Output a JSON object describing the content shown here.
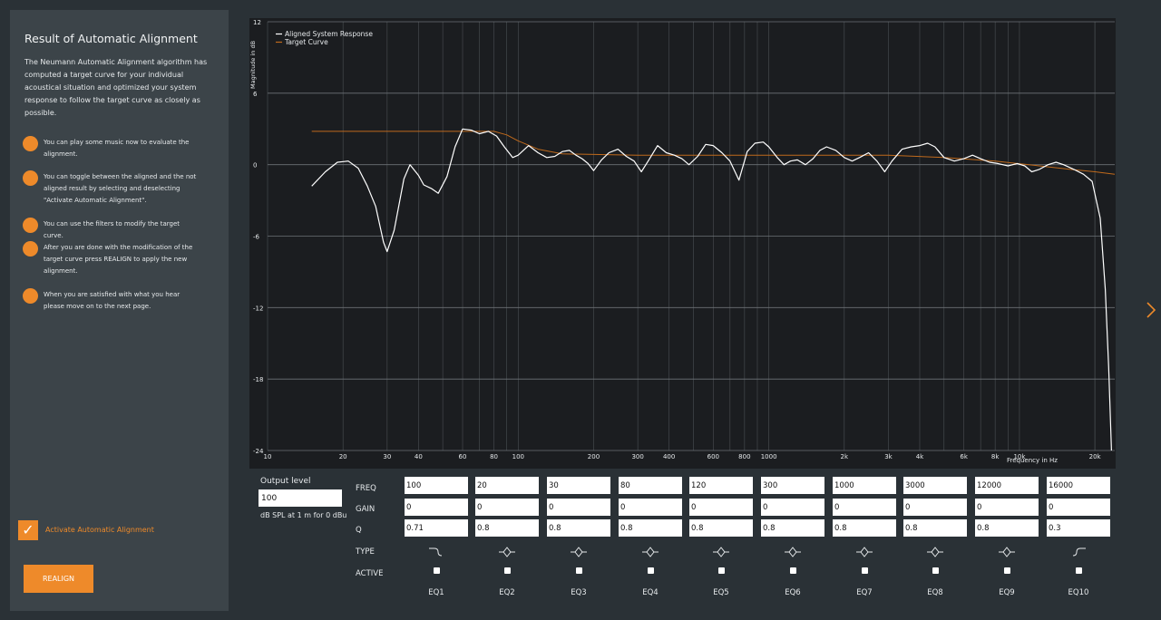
{
  "sidebar": {
    "title": "Result of Automatic Alignment",
    "description": "The Neumann Automatic Alignment algorithm has computed a target curve for your individual acoustical situation and optimized your system response to follow the target curve as closely as possible.",
    "tips": [
      "You can play some music now to evaluate the alignment.",
      "You can toggle between the aligned and the not aligned result by selecting and deselecting \"Activate Automatic Alignment\".",
      "You can use the filters to modify the target curve.",
      "After you are done with the modification of the target curve press REALIGN to apply the new alignment.",
      "When you are satisfied with what you hear please move on to the next page."
    ],
    "activate_checked": true,
    "activate_label": "Activate Automatic Alignment",
    "realign_label": "REALIGN"
  },
  "output": {
    "label": "Output level",
    "value": "100",
    "unit": "dB SPL at 1 m for 0 dBu"
  },
  "eq": {
    "row_labels": {
      "freq": "FREQ",
      "gain": "GAIN",
      "q": "Q",
      "type": "TYPE",
      "active": "ACTIVE"
    },
    "bands": [
      {
        "name": "EQ1",
        "freq": "100",
        "gain": "0",
        "q": "0.71",
        "type": "low-shelf-icon",
        "active": false
      },
      {
        "name": "EQ2",
        "freq": "20",
        "gain": "0",
        "q": "0.8",
        "type": "peak-icon",
        "active": false
      },
      {
        "name": "EQ3",
        "freq": "30",
        "gain": "0",
        "q": "0.8",
        "type": "peak-icon",
        "active": false
      },
      {
        "name": "EQ4",
        "freq": "80",
        "gain": "0",
        "q": "0.8",
        "type": "peak-icon",
        "active": false
      },
      {
        "name": "EQ5",
        "freq": "120",
        "gain": "0",
        "q": "0.8",
        "type": "peak-icon",
        "active": false
      },
      {
        "name": "EQ6",
        "freq": "300",
        "gain": "0",
        "q": "0.8",
        "type": "peak-icon",
        "active": false
      },
      {
        "name": "EQ7",
        "freq": "1000",
        "gain": "0",
        "q": "0.8",
        "type": "peak-icon",
        "active": false
      },
      {
        "name": "EQ8",
        "freq": "3000",
        "gain": "0",
        "q": "0.8",
        "type": "peak-icon",
        "active": false
      },
      {
        "name": "EQ9",
        "freq": "12000",
        "gain": "0",
        "q": "0.8",
        "type": "peak-icon",
        "active": false
      },
      {
        "name": "EQ10",
        "freq": "16000",
        "gain": "0",
        "q": "0.3",
        "type": "high-shelf-icon",
        "active": false
      }
    ]
  },
  "colors": {
    "accent": "#ee8a2a",
    "response": "#ffffff",
    "target": "#c06a1c"
  },
  "chart_data": {
    "type": "line",
    "xlabel": "Frequency in Hz",
    "ylabel": "Magnitude in dB",
    "xscale": "log",
    "xlim": [
      10,
      24000
    ],
    "ylim": [
      -24,
      12
    ],
    "xticks": [
      {
        "v": 10,
        "label": "10"
      },
      {
        "v": 20,
        "label": "20"
      },
      {
        "v": 30,
        "label": "30"
      },
      {
        "v": 40,
        "label": "40"
      },
      {
        "v": 60,
        "label": "60"
      },
      {
        "v": 80,
        "label": "80"
      },
      {
        "v": 100,
        "label": "100"
      },
      {
        "v": 200,
        "label": "200"
      },
      {
        "v": 300,
        "label": "300"
      },
      {
        "v": 400,
        "label": "400"
      },
      {
        "v": 600,
        "label": "600"
      },
      {
        "v": 800,
        "label": "800"
      },
      {
        "v": 1000,
        "label": "1000"
      },
      {
        "v": 2000,
        "label": "2k"
      },
      {
        "v": 3000,
        "label": "3k"
      },
      {
        "v": 4000,
        "label": "4k"
      },
      {
        "v": 6000,
        "label": "6k"
      },
      {
        "v": 8000,
        "label": "8k"
      },
      {
        "v": 10000,
        "label": "10k"
      },
      {
        "v": 20000,
        "label": "20k"
      }
    ],
    "yticks": [
      12,
      6,
      0,
      -6,
      -12,
      -18,
      -24
    ],
    "legend_position": "top-left",
    "grid": true,
    "series": [
      {
        "name": "Aligned System Response",
        "color": "#ffffff",
        "points": [
          [
            15,
            -1.8
          ],
          [
            17,
            -0.6
          ],
          [
            19,
            0.2
          ],
          [
            21,
            0.3
          ],
          [
            23,
            -0.3
          ],
          [
            25,
            -1.8
          ],
          [
            27,
            -3.5
          ],
          [
            29,
            -6.5
          ],
          [
            30,
            -7.3
          ],
          [
            32,
            -5.5
          ],
          [
            35,
            -1.2
          ],
          [
            37,
            0
          ],
          [
            40,
            -0.9
          ],
          [
            42,
            -1.7
          ],
          [
            45,
            -2.0
          ],
          [
            48,
            -2.4
          ],
          [
            52,
            -1.0
          ],
          [
            56,
            1.5
          ],
          [
            60,
            3.0
          ],
          [
            65,
            2.9
          ],
          [
            70,
            2.6
          ],
          [
            76,
            2.8
          ],
          [
            82,
            2.4
          ],
          [
            88,
            1.5
          ],
          [
            95,
            0.6
          ],
          [
            100,
            0.8
          ],
          [
            110,
            1.6
          ],
          [
            120,
            1.0
          ],
          [
            130,
            0.6
          ],
          [
            140,
            0.7
          ],
          [
            150,
            1.1
          ],
          [
            160,
            1.2
          ],
          [
            170,
            0.8
          ],
          [
            180,
            0.5
          ],
          [
            190,
            0.1
          ],
          [
            200,
            -0.5
          ],
          [
            215,
            0.4
          ],
          [
            230,
            1.0
          ],
          [
            250,
            1.3
          ],
          [
            270,
            0.7
          ],
          [
            290,
            0.3
          ],
          [
            310,
            -0.6
          ],
          [
            330,
            0.3
          ],
          [
            360,
            1.6
          ],
          [
            390,
            1.0
          ],
          [
            420,
            0.8
          ],
          [
            450,
            0.5
          ],
          [
            480,
            0
          ],
          [
            520,
            0.7
          ],
          [
            560,
            1.7
          ],
          [
            600,
            1.6
          ],
          [
            650,
            1.0
          ],
          [
            700,
            0.3
          ],
          [
            760,
            -1.3
          ],
          [
            820,
            1.1
          ],
          [
            880,
            1.8
          ],
          [
            950,
            1.9
          ],
          [
            1000,
            1.5
          ],
          [
            1080,
            0.6
          ],
          [
            1150,
            0.0
          ],
          [
            1220,
            0.3
          ],
          [
            1300,
            0.4
          ],
          [
            1400,
            0.0
          ],
          [
            1500,
            0.5
          ],
          [
            1600,
            1.2
          ],
          [
            1700,
            1.5
          ],
          [
            1850,
            1.2
          ],
          [
            2000,
            0.6
          ],
          [
            2150,
            0.3
          ],
          [
            2300,
            0.6
          ],
          [
            2500,
            1.0
          ],
          [
            2700,
            0.3
          ],
          [
            2900,
            -0.6
          ],
          [
            3100,
            0.3
          ],
          [
            3400,
            1.3
          ],
          [
            3700,
            1.5
          ],
          [
            4000,
            1.6
          ],
          [
            4300,
            1.8
          ],
          [
            4600,
            1.5
          ],
          [
            5000,
            0.6
          ],
          [
            5500,
            0.3
          ],
          [
            6000,
            0.5
          ],
          [
            6500,
            0.8
          ],
          [
            7000,
            0.5
          ],
          [
            7600,
            0.2
          ],
          [
            8200,
            0.1
          ],
          [
            9000,
            -0.1
          ],
          [
            9800,
            0.1
          ],
          [
            10500,
            -0.1
          ],
          [
            11200,
            -0.6
          ],
          [
            12000,
            -0.4
          ],
          [
            13000,
            0.0
          ],
          [
            14000,
            0.2
          ],
          [
            15000,
            0.0
          ],
          [
            16500,
            -0.4
          ],
          [
            18000,
            -0.8
          ],
          [
            19500,
            -1.4
          ],
          [
            21000,
            -4.5
          ],
          [
            22000,
            -10.5
          ],
          [
            22700,
            -17
          ],
          [
            23300,
            -24
          ]
        ]
      },
      {
        "name": "Target Curve",
        "color": "#c06a1c",
        "points": [
          [
            15,
            2.8
          ],
          [
            30,
            2.8
          ],
          [
            60,
            2.8
          ],
          [
            80,
            2.8
          ],
          [
            90,
            2.5
          ],
          [
            100,
            2.0
          ],
          [
            120,
            1.3
          ],
          [
            150,
            0.9
          ],
          [
            300,
            0.8
          ],
          [
            1000,
            0.8
          ],
          [
            3000,
            0.8
          ],
          [
            5000,
            0.6
          ],
          [
            8000,
            0.3
          ],
          [
            12000,
            -0.1
          ],
          [
            16000,
            -0.4
          ],
          [
            20000,
            -0.6
          ],
          [
            24000,
            -0.8
          ]
        ]
      }
    ]
  }
}
